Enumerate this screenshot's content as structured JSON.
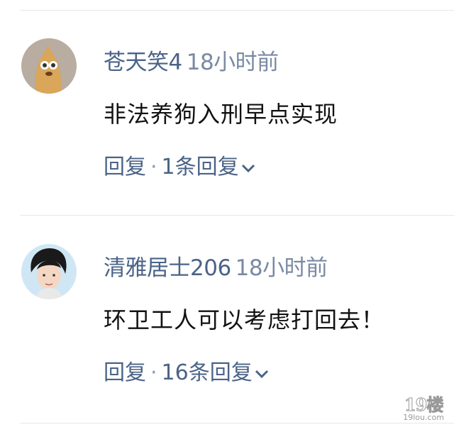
{
  "comments": [
    {
      "username": "苍天笑4",
      "time": "18小时前",
      "text": "非法养狗入刑早点实现",
      "reply_label": "回复",
      "separator": "·",
      "reply_count": "1条回复"
    },
    {
      "username": "清雅居士206",
      "time": "18小时前",
      "text": "环卫工人可以考虑打回去！",
      "reply_label": "回复",
      "separator": "·",
      "reply_count": "16条回复"
    }
  ],
  "watermark": {
    "mark": "19楼",
    "site": "19lou.com"
  },
  "colors": {
    "username": "#4a6387",
    "time": "#7a8aa3",
    "text": "#111111",
    "divider": "#e8e8e8"
  }
}
